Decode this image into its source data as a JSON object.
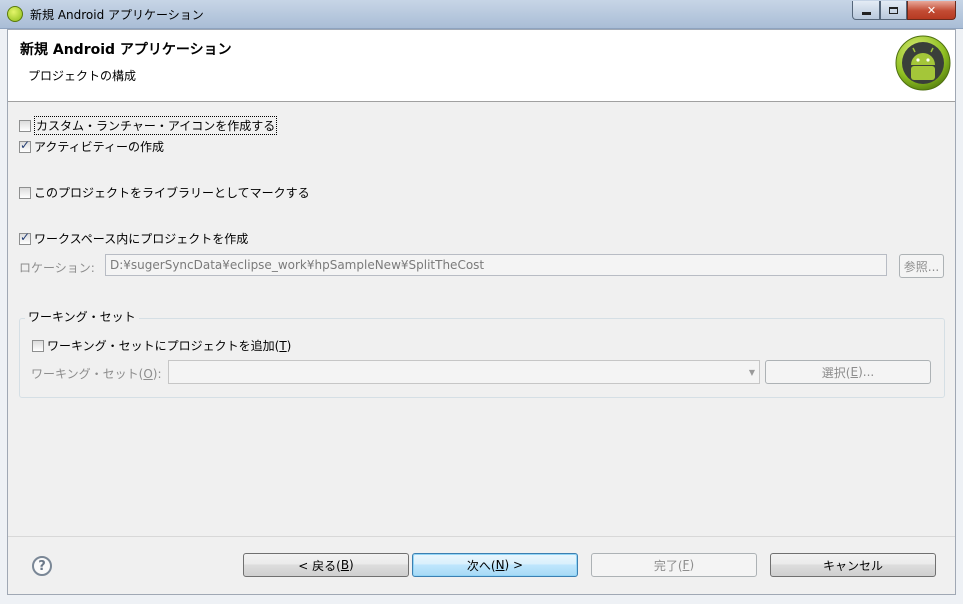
{
  "window": {
    "title": "新規 Android アプリケーション"
  },
  "header": {
    "title": "新規 Android アプリケーション",
    "subtitle": "プロジェクトの構成"
  },
  "options": {
    "custom_icon": {
      "label": "カスタム・ランチャー・アイコンを作成する",
      "checked": false
    },
    "create_activity": {
      "label": "アクティビティーの作成",
      "checked": true
    },
    "library": {
      "label": "このプロジェクトをライブラリーとしてマークする",
      "checked": false
    },
    "workspace": {
      "label": "ワークスペース内にプロジェクトを作成",
      "checked": true
    }
  },
  "location": {
    "label": "ロケーション:",
    "value": "D:¥sugerSyncData¥eclipse_work¥hpSampleNew¥SplitTheCost",
    "browse_label": "参照..."
  },
  "working_set": {
    "group_title": "ワーキング・セット",
    "add_label_prefix": "ワーキング・セットにプロジェクトを追加(",
    "add_label_mnemonic": "T",
    "add_label_suffix": ")",
    "add_checked": false,
    "ws_label_prefix": "ワーキング・セット(",
    "ws_label_mnemonic": "O",
    "ws_label_suffix": "):",
    "select_prefix": "選択(",
    "select_mnemonic": "E",
    "select_suffix": ")..."
  },
  "footer": {
    "help_glyph": "?",
    "back_prefix": "< 戻る(",
    "back_mnemonic": "B",
    "back_suffix": ")",
    "next_prefix": "次へ(",
    "next_mnemonic": "N",
    "next_suffix": ") >",
    "finish_prefix": "完了(",
    "finish_mnemonic": "F",
    "finish_suffix": ")",
    "cancel_label": "キャンセル"
  },
  "colors": {
    "android_green": "#a4c639",
    "default_button_border": "#3c7fb1"
  }
}
